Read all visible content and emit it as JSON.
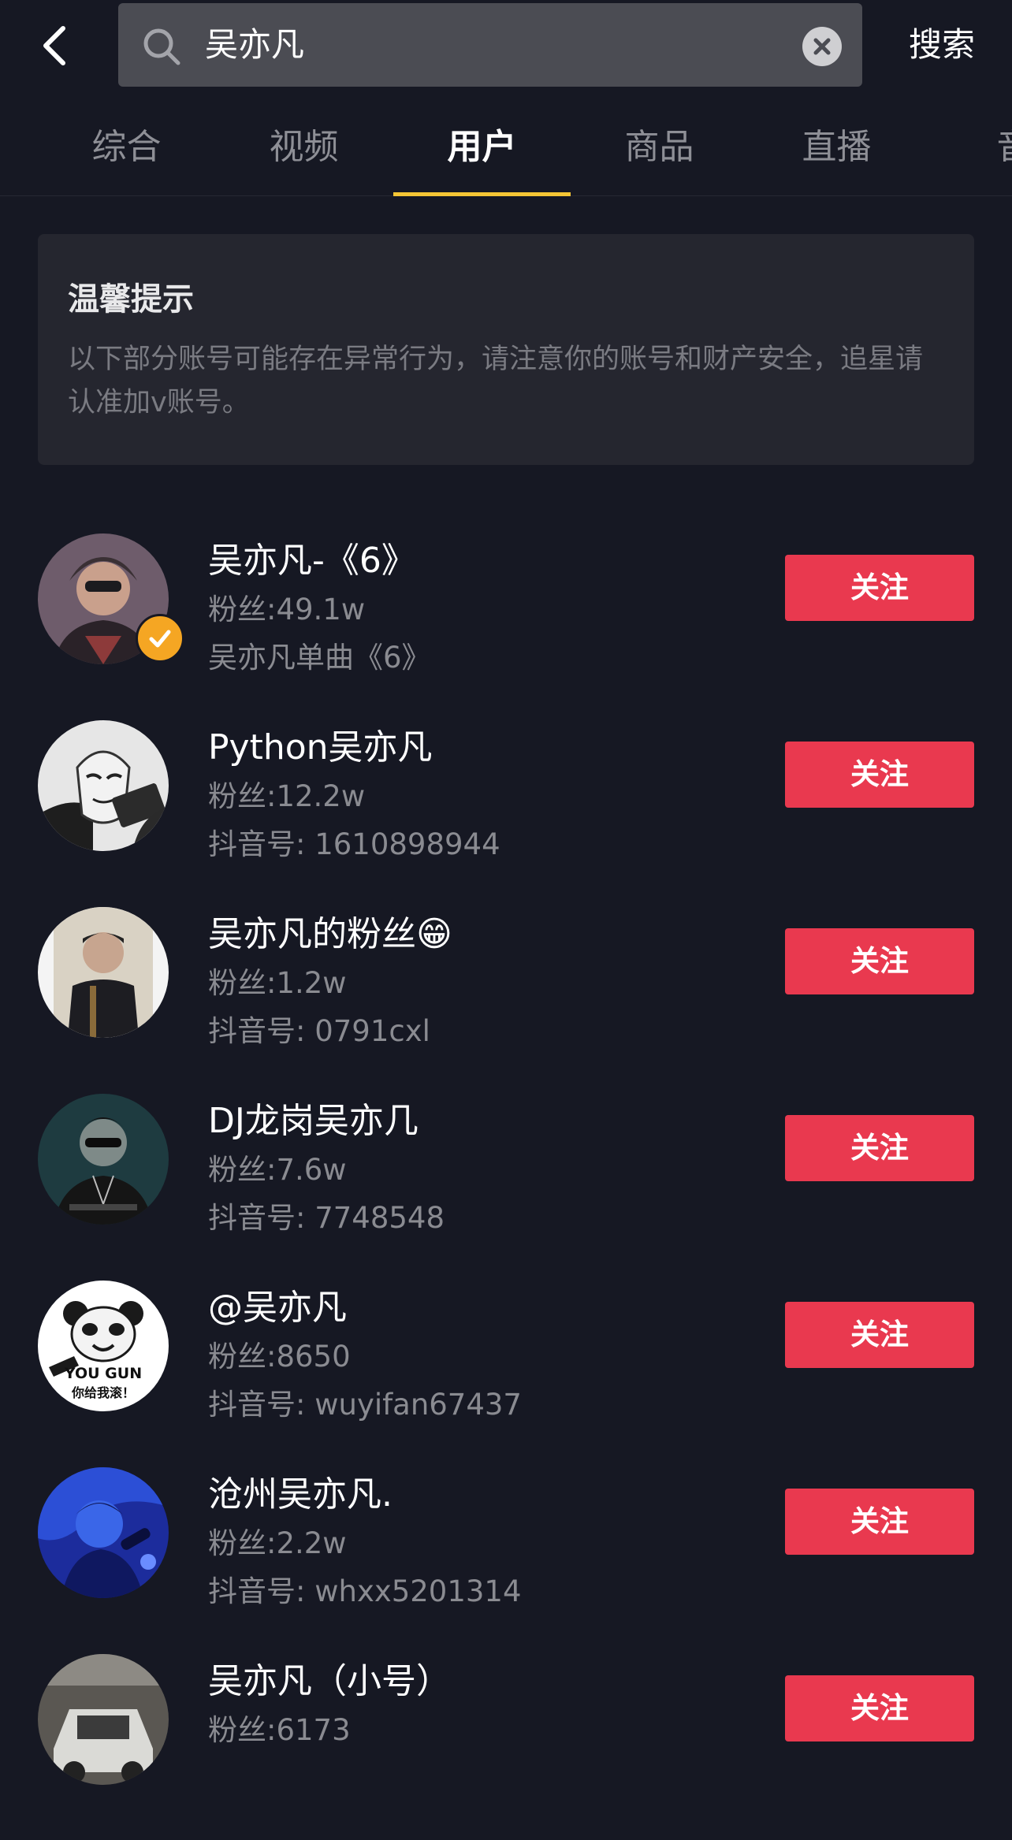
{
  "header": {
    "search_query": "吴亦凡",
    "search_button": "搜索"
  },
  "tabs": [
    {
      "label": "综合"
    },
    {
      "label": "视频"
    },
    {
      "label": "用户",
      "active": true
    },
    {
      "label": "商品"
    },
    {
      "label": "直播"
    },
    {
      "label": "音"
    }
  ],
  "notice": {
    "title": "温馨提示",
    "body": "以下部分账号可能存在异常行为，请注意你的账号和财产安全，追星请认准加v账号。"
  },
  "users": [
    {
      "name": "吴亦凡-《6》",
      "fans": "粉丝:49.1w",
      "sub": "吴亦凡单曲《6》",
      "verified": true,
      "follow": "关注"
    },
    {
      "name": "Python吴亦凡",
      "fans": "粉丝:12.2w",
      "sub": "抖音号: 1610898944",
      "follow": "关注"
    },
    {
      "name": "吴亦凡的粉丝😁",
      "fans": "粉丝:1.2w",
      "sub": "抖音号: 0791cxl",
      "follow": "关注"
    },
    {
      "name": "DJ龙岗吴亦几",
      "fans": "粉丝:7.6w",
      "sub": "抖音号: 7748548",
      "follow": "关注"
    },
    {
      "name": "@吴亦凡",
      "fans": "粉丝:8650",
      "sub": "抖音号: wuyifan67437",
      "follow": "关注"
    },
    {
      "name": "沧州吴亦凡.",
      "fans": "粉丝:2.2w",
      "sub": "抖音号: whxx5201314",
      "follow": "关注"
    },
    {
      "name": "吴亦凡（小号）",
      "fans": "粉丝:6173",
      "sub": "",
      "follow": "关注"
    }
  ],
  "avatar_texts": {
    "panda_line1": "YOU GUN",
    "panda_line2": "你给我滚！"
  },
  "colors": {
    "background": "#161823",
    "follow_button": "#e9394f",
    "tab_indicator": "#f5c635",
    "verified_badge": "#f5a623"
  }
}
